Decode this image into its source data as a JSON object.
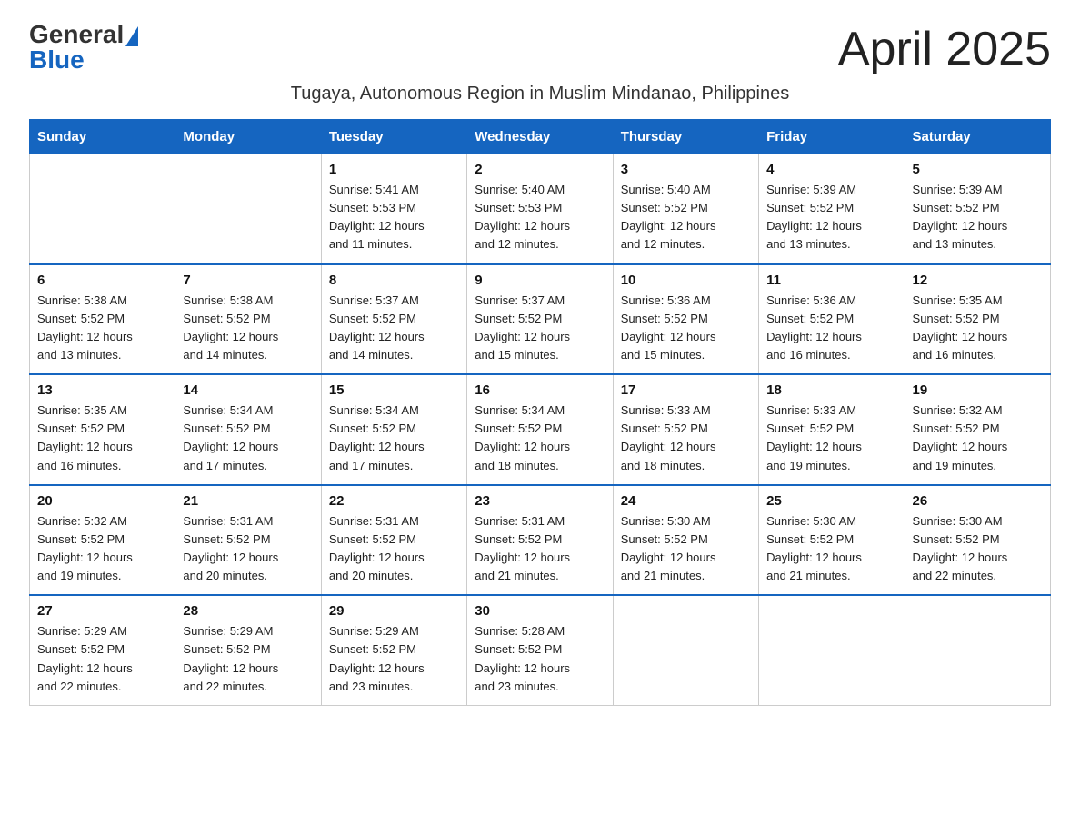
{
  "logo": {
    "general": "General",
    "blue": "Blue"
  },
  "title": "April 2025",
  "subtitle": "Tugaya, Autonomous Region in Muslim Mindanao, Philippines",
  "days_of_week": [
    "Sunday",
    "Monday",
    "Tuesday",
    "Wednesday",
    "Thursday",
    "Friday",
    "Saturday"
  ],
  "weeks": [
    [
      {
        "day": "",
        "info": ""
      },
      {
        "day": "",
        "info": ""
      },
      {
        "day": "1",
        "info": "Sunrise: 5:41 AM\nSunset: 5:53 PM\nDaylight: 12 hours\nand 11 minutes."
      },
      {
        "day": "2",
        "info": "Sunrise: 5:40 AM\nSunset: 5:53 PM\nDaylight: 12 hours\nand 12 minutes."
      },
      {
        "day": "3",
        "info": "Sunrise: 5:40 AM\nSunset: 5:52 PM\nDaylight: 12 hours\nand 12 minutes."
      },
      {
        "day": "4",
        "info": "Sunrise: 5:39 AM\nSunset: 5:52 PM\nDaylight: 12 hours\nand 13 minutes."
      },
      {
        "day": "5",
        "info": "Sunrise: 5:39 AM\nSunset: 5:52 PM\nDaylight: 12 hours\nand 13 minutes."
      }
    ],
    [
      {
        "day": "6",
        "info": "Sunrise: 5:38 AM\nSunset: 5:52 PM\nDaylight: 12 hours\nand 13 minutes."
      },
      {
        "day": "7",
        "info": "Sunrise: 5:38 AM\nSunset: 5:52 PM\nDaylight: 12 hours\nand 14 minutes."
      },
      {
        "day": "8",
        "info": "Sunrise: 5:37 AM\nSunset: 5:52 PM\nDaylight: 12 hours\nand 14 minutes."
      },
      {
        "day": "9",
        "info": "Sunrise: 5:37 AM\nSunset: 5:52 PM\nDaylight: 12 hours\nand 15 minutes."
      },
      {
        "day": "10",
        "info": "Sunrise: 5:36 AM\nSunset: 5:52 PM\nDaylight: 12 hours\nand 15 minutes."
      },
      {
        "day": "11",
        "info": "Sunrise: 5:36 AM\nSunset: 5:52 PM\nDaylight: 12 hours\nand 16 minutes."
      },
      {
        "day": "12",
        "info": "Sunrise: 5:35 AM\nSunset: 5:52 PM\nDaylight: 12 hours\nand 16 minutes."
      }
    ],
    [
      {
        "day": "13",
        "info": "Sunrise: 5:35 AM\nSunset: 5:52 PM\nDaylight: 12 hours\nand 16 minutes."
      },
      {
        "day": "14",
        "info": "Sunrise: 5:34 AM\nSunset: 5:52 PM\nDaylight: 12 hours\nand 17 minutes."
      },
      {
        "day": "15",
        "info": "Sunrise: 5:34 AM\nSunset: 5:52 PM\nDaylight: 12 hours\nand 17 minutes."
      },
      {
        "day": "16",
        "info": "Sunrise: 5:34 AM\nSunset: 5:52 PM\nDaylight: 12 hours\nand 18 minutes."
      },
      {
        "day": "17",
        "info": "Sunrise: 5:33 AM\nSunset: 5:52 PM\nDaylight: 12 hours\nand 18 minutes."
      },
      {
        "day": "18",
        "info": "Sunrise: 5:33 AM\nSunset: 5:52 PM\nDaylight: 12 hours\nand 19 minutes."
      },
      {
        "day": "19",
        "info": "Sunrise: 5:32 AM\nSunset: 5:52 PM\nDaylight: 12 hours\nand 19 minutes."
      }
    ],
    [
      {
        "day": "20",
        "info": "Sunrise: 5:32 AM\nSunset: 5:52 PM\nDaylight: 12 hours\nand 19 minutes."
      },
      {
        "day": "21",
        "info": "Sunrise: 5:31 AM\nSunset: 5:52 PM\nDaylight: 12 hours\nand 20 minutes."
      },
      {
        "day": "22",
        "info": "Sunrise: 5:31 AM\nSunset: 5:52 PM\nDaylight: 12 hours\nand 20 minutes."
      },
      {
        "day": "23",
        "info": "Sunrise: 5:31 AM\nSunset: 5:52 PM\nDaylight: 12 hours\nand 21 minutes."
      },
      {
        "day": "24",
        "info": "Sunrise: 5:30 AM\nSunset: 5:52 PM\nDaylight: 12 hours\nand 21 minutes."
      },
      {
        "day": "25",
        "info": "Sunrise: 5:30 AM\nSunset: 5:52 PM\nDaylight: 12 hours\nand 21 minutes."
      },
      {
        "day": "26",
        "info": "Sunrise: 5:30 AM\nSunset: 5:52 PM\nDaylight: 12 hours\nand 22 minutes."
      }
    ],
    [
      {
        "day": "27",
        "info": "Sunrise: 5:29 AM\nSunset: 5:52 PM\nDaylight: 12 hours\nand 22 minutes."
      },
      {
        "day": "28",
        "info": "Sunrise: 5:29 AM\nSunset: 5:52 PM\nDaylight: 12 hours\nand 22 minutes."
      },
      {
        "day": "29",
        "info": "Sunrise: 5:29 AM\nSunset: 5:52 PM\nDaylight: 12 hours\nand 23 minutes."
      },
      {
        "day": "30",
        "info": "Sunrise: 5:28 AM\nSunset: 5:52 PM\nDaylight: 12 hours\nand 23 minutes."
      },
      {
        "day": "",
        "info": ""
      },
      {
        "day": "",
        "info": ""
      },
      {
        "day": "",
        "info": ""
      }
    ]
  ]
}
